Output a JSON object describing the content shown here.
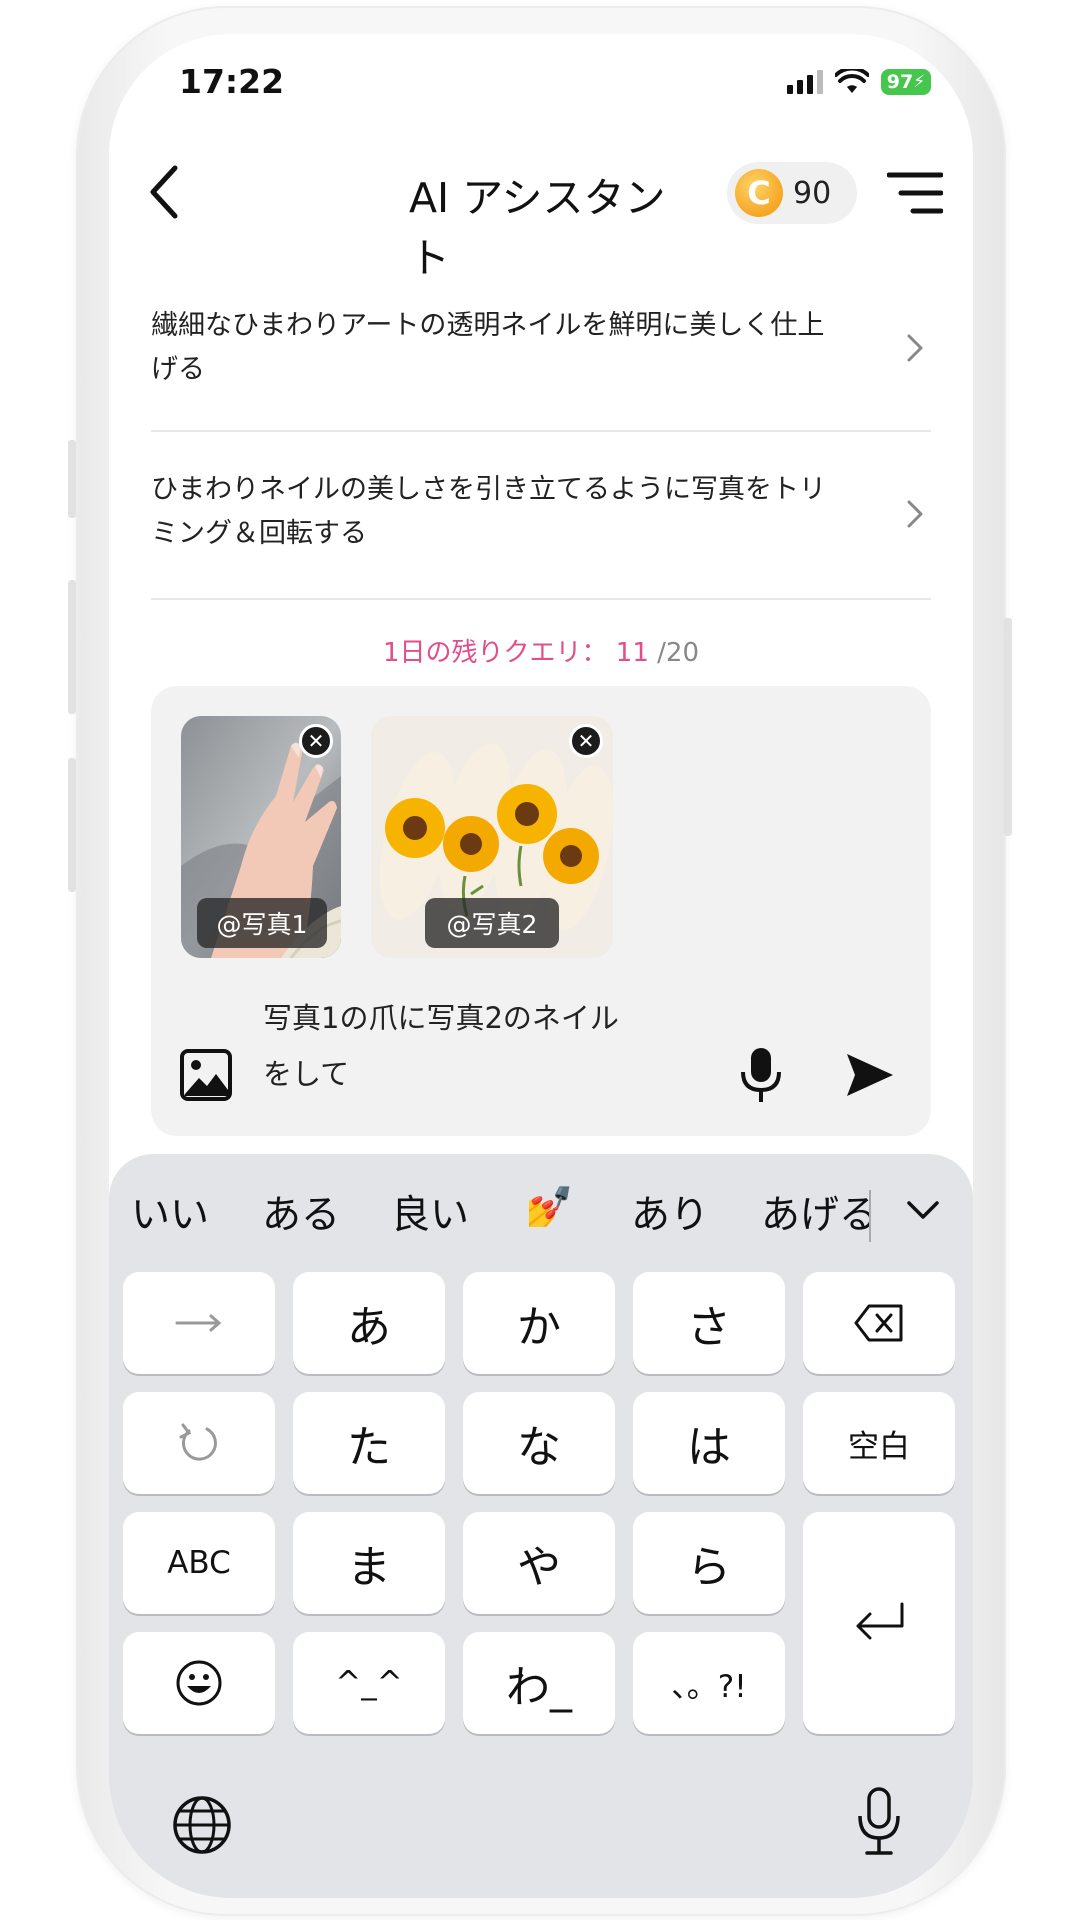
{
  "status": {
    "time": "17:22",
    "battery": "97"
  },
  "header": {
    "title": "AI アシスタント",
    "coins": "90",
    "coin_symbol": "C"
  },
  "suggestions": [
    {
      "line1": "繊細なひまわりアートの透明ネイルを鮮明に美しく仕上",
      "line2": "げる"
    },
    {
      "line1": "ひまわりネイルの美しさを引き立てるように写真をトリ",
      "line2": "ミング＆回転する"
    }
  ],
  "quota": {
    "label": "1日の残りクエリ：",
    "remaining": "11",
    "total": "/20"
  },
  "attachments": [
    {
      "tag": "@写真1",
      "icon": "hand-photo"
    },
    {
      "tag": "@写真2",
      "icon": "sunflower-nails-photo"
    }
  ],
  "composer": {
    "line1": "写真1の爪に写真2のネイル",
    "line2": "をして"
  },
  "keyboard": {
    "candidates": [
      "いい",
      "ある",
      "良い",
      "💅",
      "あり",
      "あげる"
    ],
    "keys": {
      "a": "あ",
      "ka": "か",
      "sa": "さ",
      "ta": "た",
      "na": "な",
      "ha": "は",
      "space": "空白",
      "abc": "ABC",
      "ma": "ま",
      "ya": "や",
      "ra": "ら",
      "kaomoji": "^_^",
      "wa": "わ_",
      "punct": "、。?!"
    }
  }
}
